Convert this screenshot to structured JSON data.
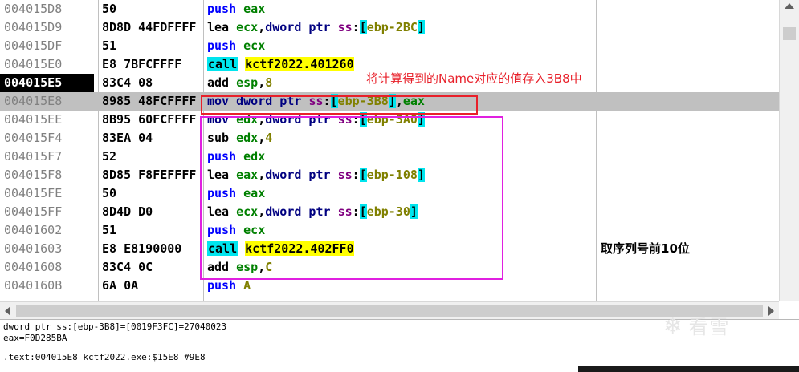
{
  "rows": [
    {
      "addr": "004015D8",
      "bytes": "50",
      "instr": [
        [
          "push",
          "m-push"
        ],
        [
          " "
        ],
        [
          "eax",
          "reg"
        ]
      ],
      "comment": ""
    },
    {
      "addr": "004015D9",
      "bytes": "8D8D 44FDFFFF",
      "instr": [
        [
          "lea",
          "plain"
        ],
        [
          " "
        ],
        [
          "ecx",
          "reg"
        ],
        [
          ","
        ],
        [
          "dword ptr",
          "kw"
        ],
        [
          " "
        ],
        [
          "ss",
          "seg"
        ],
        [
          ":"
        ],
        [
          "[",
          "br"
        ],
        [
          "ebp-2BC",
          "num"
        ],
        [
          "]",
          "br"
        ]
      ],
      "comment": ""
    },
    {
      "addr": "004015DF",
      "bytes": "51",
      "instr": [
        [
          "push",
          "m-push"
        ],
        [
          " "
        ],
        [
          "ecx",
          "reg"
        ]
      ],
      "comment": ""
    },
    {
      "addr": "004015E0",
      "bytes": "E8 7BFCFFFF",
      "instr": [
        [
          "call",
          "m-call"
        ],
        [
          " "
        ],
        [
          "kctf2022.401260",
          "tgt"
        ]
      ],
      "comment": ""
    },
    {
      "addr": "004015E5",
      "bytes": "83C4 08",
      "instr": [
        [
          "add",
          "plain"
        ],
        [
          " "
        ],
        [
          "esp",
          "reg"
        ],
        [
          ","
        ],
        [
          "8",
          "num"
        ]
      ],
      "comment": "",
      "current": true
    },
    {
      "addr": "004015E8",
      "bytes": "8985 48FCFFFF",
      "instr": [
        [
          "mov",
          "m-mov"
        ],
        [
          " "
        ],
        [
          "dword ptr",
          "kw"
        ],
        [
          " "
        ],
        [
          "ss",
          "seg"
        ],
        [
          ":"
        ],
        [
          "[",
          "br"
        ],
        [
          "ebp-3B8",
          "num"
        ],
        [
          "]",
          "br"
        ],
        [
          ","
        ],
        [
          "eax",
          "reg"
        ]
      ],
      "comment": "",
      "selected": true
    },
    {
      "addr": "004015EE",
      "bytes": "8B95 60FCFFFF",
      "instr": [
        [
          "mov",
          "m-mov"
        ],
        [
          " "
        ],
        [
          "edx",
          "reg"
        ],
        [
          ","
        ],
        [
          "dword ptr",
          "kw"
        ],
        [
          " "
        ],
        [
          "ss",
          "seg"
        ],
        [
          ":"
        ],
        [
          "[",
          "br"
        ],
        [
          "ebp-3A0",
          "num"
        ],
        [
          "]",
          "br"
        ]
      ],
      "comment": ""
    },
    {
      "addr": "004015F4",
      "bytes": "83EA 04",
      "instr": [
        [
          "sub",
          "plain"
        ],
        [
          " "
        ],
        [
          "edx",
          "reg"
        ],
        [
          ","
        ],
        [
          "4",
          "num"
        ]
      ],
      "comment": ""
    },
    {
      "addr": "004015F7",
      "bytes": "52",
      "instr": [
        [
          "push",
          "m-push"
        ],
        [
          " "
        ],
        [
          "edx",
          "reg"
        ]
      ],
      "comment": ""
    },
    {
      "addr": "004015F8",
      "bytes": "8D85 F8FEFFFF",
      "instr": [
        [
          "lea",
          "plain"
        ],
        [
          " "
        ],
        [
          "eax",
          "reg"
        ],
        [
          ","
        ],
        [
          "dword ptr",
          "kw"
        ],
        [
          " "
        ],
        [
          "ss",
          "seg"
        ],
        [
          ":"
        ],
        [
          "[",
          "br"
        ],
        [
          "ebp-108",
          "num"
        ],
        [
          "]",
          "br"
        ]
      ],
      "comment": ""
    },
    {
      "addr": "004015FE",
      "bytes": "50",
      "instr": [
        [
          "push",
          "m-push"
        ],
        [
          " "
        ],
        [
          "eax",
          "reg"
        ]
      ],
      "comment": ""
    },
    {
      "addr": "004015FF",
      "bytes": "8D4D D0",
      "instr": [
        [
          "lea",
          "plain"
        ],
        [
          " "
        ],
        [
          "ecx",
          "reg"
        ],
        [
          ","
        ],
        [
          "dword ptr",
          "kw"
        ],
        [
          " "
        ],
        [
          "ss",
          "seg"
        ],
        [
          ":"
        ],
        [
          "[",
          "br"
        ],
        [
          "ebp-30",
          "num"
        ],
        [
          "]",
          "br"
        ]
      ],
      "comment": ""
    },
    {
      "addr": "00401602",
      "bytes": "51",
      "instr": [
        [
          "push",
          "m-push"
        ],
        [
          " "
        ],
        [
          "ecx",
          "reg"
        ]
      ],
      "comment": ""
    },
    {
      "addr": "00401603",
      "bytes": "E8 E8190000",
      "instr": [
        [
          "call",
          "m-call"
        ],
        [
          " "
        ],
        [
          "kctf2022.402FF0",
          "tgt"
        ]
      ],
      "comment": "取序列号前10位"
    },
    {
      "addr": "00401608",
      "bytes": "83C4 0C",
      "instr": [
        [
          "add",
          "plain"
        ],
        [
          " "
        ],
        [
          "esp",
          "reg"
        ],
        [
          ","
        ],
        [
          "C",
          "num"
        ]
      ],
      "comment": ""
    },
    {
      "addr": "0040160B",
      "bytes": "6A 0A",
      "instr": [
        [
          "push",
          "m-push"
        ],
        [
          " "
        ],
        [
          "A",
          "num"
        ]
      ],
      "comment": ""
    }
  ],
  "annotation": {
    "text": "将计算得到的Name对应的值存入3B8中"
  },
  "info": {
    "line1": "dword ptr ss:[ebp-3B8]=[0019F3FC]=27040023",
    "line2": "eax=F0D285BA",
    "line3": ".text:004015E8 kctf2022.exe:$15E8 #9E8"
  },
  "watermark": {
    "text": "看雪"
  }
}
